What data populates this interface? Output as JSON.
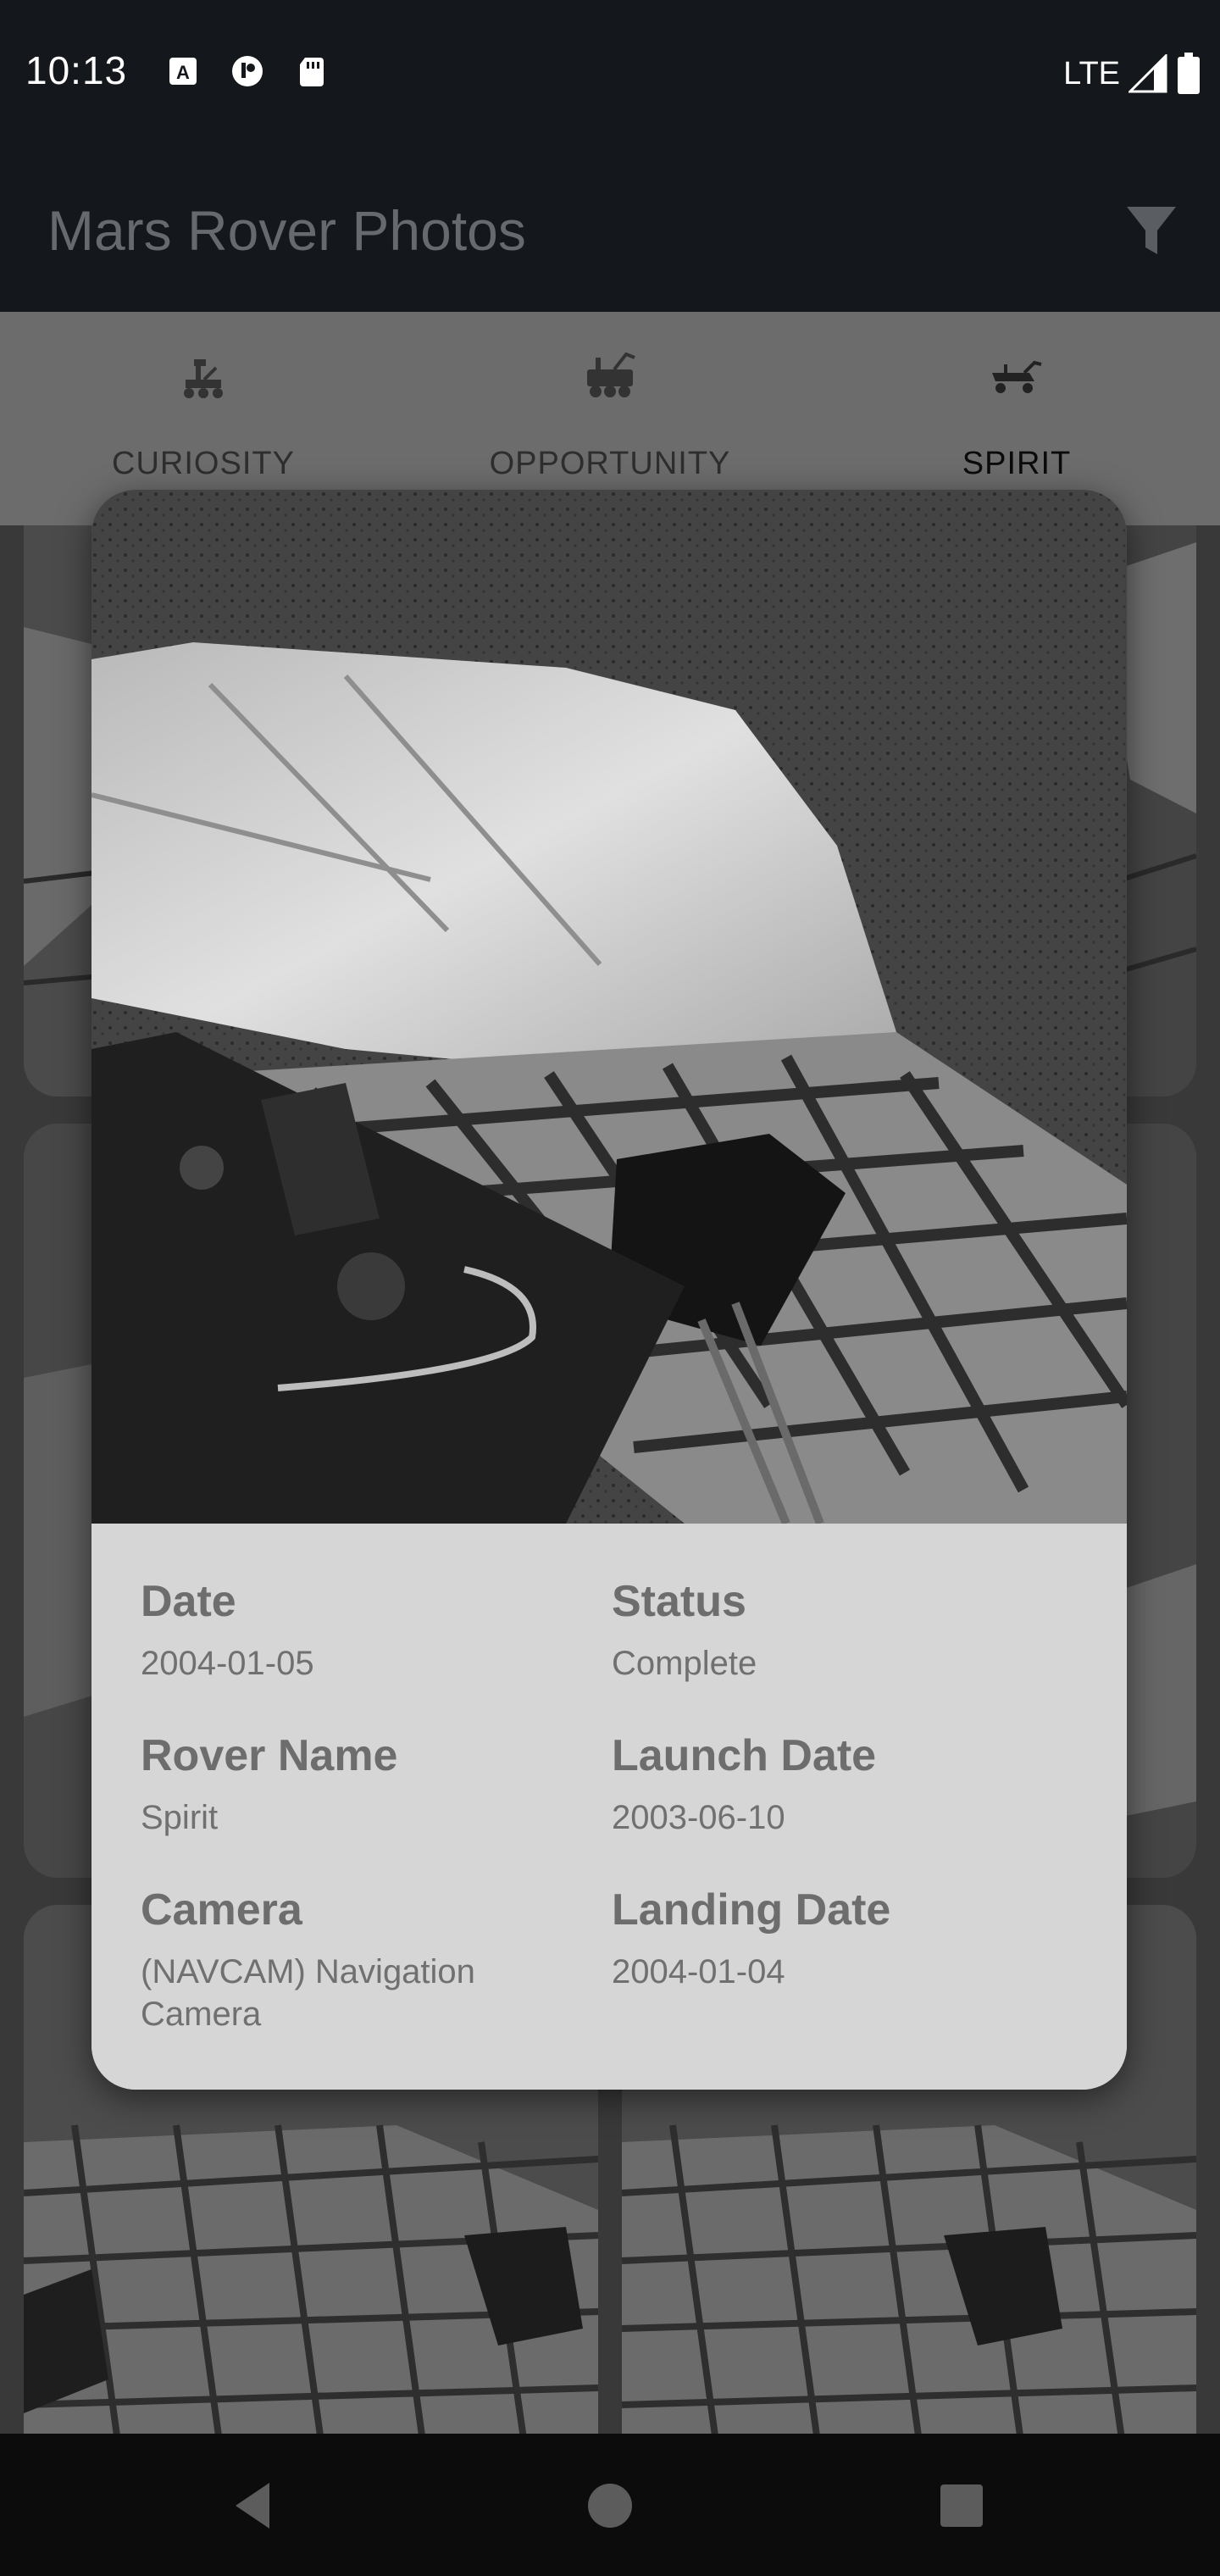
{
  "status_bar": {
    "time": "10:13",
    "network": "LTE",
    "icons": [
      "a-icon",
      "app-icon",
      "sd-card-icon",
      "signal-icon",
      "battery-icon"
    ]
  },
  "app_bar": {
    "title": "Mars Rover Photos",
    "filter_icon": "filter-icon"
  },
  "tabs": [
    {
      "label": "CURIOSITY",
      "icon": "rover-icon",
      "active": false
    },
    {
      "label": "OPPORTUNITY",
      "icon": "rover-icon",
      "active": false
    },
    {
      "label": "SPIRIT",
      "icon": "rover-icon",
      "active": true
    }
  ],
  "photo_details": {
    "date_label": "Date",
    "date_value": "2004-01-05",
    "status_label": "Status",
    "status_value": "Complete",
    "rover_label": "Rover Name",
    "rover_value": "Spirit",
    "launch_label": "Launch Date",
    "launch_value": "2003-06-10",
    "camera_label": "Camera",
    "camera_value": "(NAVCAM) Navigation Camera",
    "landing_label": "Landing Date",
    "landing_value": "2004-01-04"
  },
  "nav_bar": {
    "icons": [
      "back-icon",
      "home-icon",
      "recents-icon"
    ]
  },
  "colors": {
    "status_bar_bg": "#14171b",
    "scrim_tab_bg": "#6c6c6c",
    "modal_bg": "#d6d6d6",
    "label_text": "#6d6d6d"
  }
}
